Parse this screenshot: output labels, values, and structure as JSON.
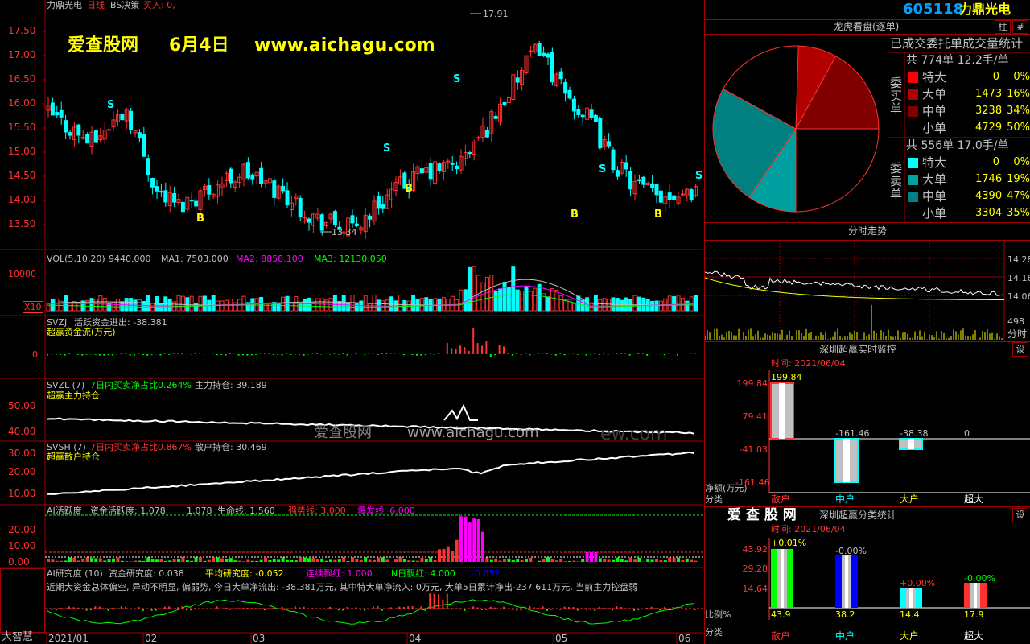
{
  "header": {
    "stock_name": "力鼎光电",
    "period": "日线",
    "indicator": "BS决策",
    "buy_text": "买入: 0,"
  },
  "watermark": {
    "site": "爱查股网",
    "date": "6月4日",
    "url": "www.aichagu.com",
    "mid_site": "爱查股网",
    "mid_url": "www.aichagu.com",
    "ghost_tail": "ew.com"
  },
  "price_axis": [
    "17.50",
    "17.00",
    "16.50",
    "16.00",
    "15.50",
    "15.00",
    "14.50",
    "14.00",
    "13.50"
  ],
  "price_marks": {
    "high": "17.91",
    "low": "13.34"
  },
  "signals": {
    "s": "S",
    "b": "B"
  },
  "vol_panel": {
    "title": "VOL(5,10,20)",
    "vol": "9440.000",
    "ma1": "MA1: 7503.000",
    "ma2": "MA2: 8858.100",
    "ma3": "MA3: 12130.050",
    "axis_top": "10000",
    "axis_unit": "X10"
  },
  "svzj_panel": {
    "title": "SVZJ",
    "line": "活跃资金进出: -38.381",
    "sub": "超赢资金流(万元)",
    "axis_zero": "0"
  },
  "svzl_panel": {
    "title": "SVZL (7)",
    "ratio": "7日内买卖净占比0.264%",
    "hold": "主力持仓: 39.189",
    "sub": "超赢主力持仓",
    "axis": [
      "50.00",
      "40.00"
    ]
  },
  "svsh_panel": {
    "title": "SVSH (7)",
    "ratio": "7日内买卖净占比0.867%",
    "hold": "散户持仓: 30.469",
    "sub": "超赢散户持仓",
    "axis": [
      "30.00",
      "20.00",
      "10.00"
    ]
  },
  "ai_panel": {
    "title": "AI活跃度",
    "fund": "资金活跃度: 1.078",
    "fund2": "1.078",
    "life": "生命线: 1.560",
    "strong": "强势线: 3.000",
    "burst": "爆发线: 6.000",
    "axis": [
      "20.00",
      "10.00",
      "0.00"
    ]
  },
  "research_panel": {
    "title": "AI研究度 (10)",
    "fund": "资金研究度: 0.038",
    "avg": "平均研究度: -0.052",
    "streak": "连续飘红: 1.000",
    "nday": "N日飘红: 4.000",
    "tail": "-0.052",
    "comment": "近期大资金总体偏空, 异动不明显, 偏弱势, 今日大单净流出: -38.381万元, 其中特大单净流入: 0万元, 大单5日累计净出-237.611万元, 当前主力控盘弱"
  },
  "left_box": {
    "label": "大智慧"
  },
  "date_axis": [
    "2021/01",
    "02",
    "03",
    "04",
    "05",
    "06"
  ],
  "right": {
    "code": "605118",
    "name": "力鼎光电",
    "btn_zhu": "柱",
    "btn_grid": "#"
  },
  "dragon": {
    "title": "龙虎看盘(逐单)",
    "stats_title": "已成交委托单成交量统计",
    "buy": {
      "side": "委买单",
      "summary": "共 774单 12.2手/单",
      "rows": [
        {
          "label": "特大",
          "count": "0",
          "pct": "0%",
          "color": "#ff0000"
        },
        {
          "label": "大单",
          "count": "1473",
          "pct": "16%",
          "color": "#b00000"
        },
        {
          "label": "中单",
          "count": "3238",
          "pct": "34%",
          "color": "#800000"
        },
        {
          "label": "小单",
          "count": "4729",
          "pct": "50%",
          "color": "#000000"
        }
      ]
    },
    "sell": {
      "side": "委卖单",
      "summary": "共 556单 17.0手/单",
      "rows": [
        {
          "label": "特大",
          "count": "0",
          "pct": "0%",
          "color": "#00ffff"
        },
        {
          "label": "大单",
          "count": "1746",
          "pct": "19%",
          "color": "#00a0a0"
        },
        {
          "label": "中单",
          "count": "4390",
          "pct": "47%",
          "color": "#008080"
        },
        {
          "label": "小单",
          "count": "3304",
          "pct": "35%",
          "color": "#000000"
        }
      ]
    }
  },
  "intraday": {
    "title": "分时走势",
    "axis": [
      "14.28",
      "14.16",
      "14.06"
    ],
    "vol": "498",
    "label": "分时"
  },
  "monitor": {
    "title": "深圳超赢实时监控",
    "btn": "设",
    "time": "时间: 2021/06/04",
    "axis": [
      "199.84",
      "79.41",
      "-41.03",
      "-161.46"
    ],
    "values": [
      {
        "label": "散户",
        "value": "199.84"
      },
      {
        "label": "中户",
        "value": "-161.46"
      },
      {
        "label": "大户",
        "value": "-38.38"
      },
      {
        "label": "超大",
        "value": "0"
      }
    ],
    "net": "净额(万元)",
    "cat": "分类"
  },
  "category": {
    "brand": "爱 查 股 网",
    "title": "深圳超赢分类统计",
    "btn": "设",
    "time": "时间: 2021/06/04",
    "axis": [
      "43.92",
      "29.28",
      "14.64"
    ],
    "changes": [
      "+0.01%",
      "-0.00%",
      "+0.00%",
      "-0.00%"
    ],
    "values": [
      {
        "label": "散户",
        "value": "43.9"
      },
      {
        "label": "中户",
        "value": "38.2"
      },
      {
        "label": "大户",
        "value": "14.4"
      },
      {
        "label": "超大",
        "value": "17.9"
      }
    ],
    "ratio": "比例%",
    "cat": "分类"
  },
  "colors": {
    "up": "#ff3232",
    "down": "#00ffff",
    "grid": "#a00000",
    "yellow": "#ffff00",
    "magenta": "#ff00ff",
    "green": "#00ff00"
  }
}
